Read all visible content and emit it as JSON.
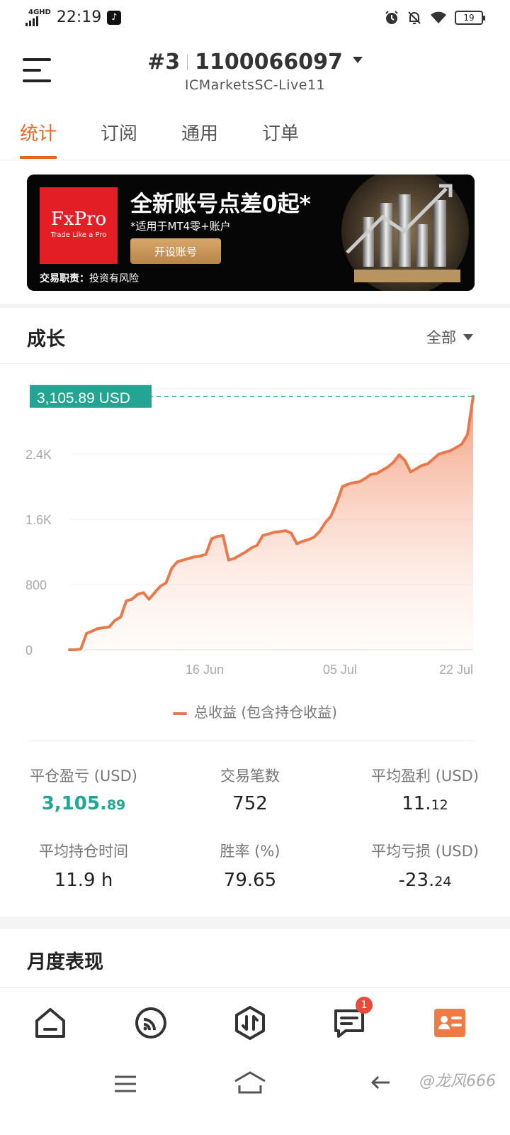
{
  "status_bar": {
    "network": "4GHD",
    "time": "22:19",
    "battery": "19"
  },
  "header": {
    "account_index": "#3",
    "account_number": "1100066097",
    "server": "ICMarketsSC-Live11"
  },
  "tabs": [
    {
      "label": "统计",
      "active": true
    },
    {
      "label": "订阅",
      "active": false
    },
    {
      "label": "通用",
      "active": false
    },
    {
      "label": "订单",
      "active": false
    }
  ],
  "banner": {
    "logo_brand": "FxPro",
    "logo_tagline": "Trade Like a Pro",
    "title": "全新账号点差0起*",
    "subtitle": "*适用于MT4零+账户",
    "button": "开设账号",
    "risk_label": "交易职责：",
    "risk_text": "投资有风险"
  },
  "growth": {
    "title": "成长",
    "filter": "全部"
  },
  "chart_data": {
    "type": "area",
    "current_value_label": "3,105.89 USD",
    "y_ticks": [
      "2.4K",
      "1.6K",
      "800",
      "0"
    ],
    "y_tick_values": [
      2400,
      1600,
      800,
      0
    ],
    "ylim": [
      0,
      3200
    ],
    "x_ticks": [
      "16 Jun",
      "05 Jul",
      "22 Jul"
    ],
    "series": [
      {
        "name": "总收益 (包含持仓收益)",
        "values": [
          0,
          0,
          10,
          200,
          230,
          260,
          270,
          280,
          360,
          400,
          600,
          620,
          680,
          700,
          620,
          700,
          780,
          820,
          1000,
          1080,
          1100,
          1120,
          1140,
          1150,
          1170,
          1360,
          1390,
          1400,
          1100,
          1120,
          1160,
          1200,
          1250,
          1280,
          1400,
          1420,
          1440,
          1450,
          1460,
          1430,
          1300,
          1330,
          1350,
          1380,
          1450,
          1560,
          1640,
          1800,
          2000,
          2030,
          2050,
          2060,
          2100,
          2150,
          2160,
          2200,
          2240,
          2300,
          2390,
          2320,
          2180,
          2220,
          2260,
          2280,
          2340,
          2400,
          2420,
          2440,
          2480,
          2520,
          2640,
          3105.89
        ],
        "color": "#e8794a"
      }
    ]
  },
  "stats": [
    {
      "label": "平仓盈亏 (USD)",
      "int": "3,105.",
      "dec": "89",
      "highlight": true
    },
    {
      "label": "交易笔数",
      "int": "752",
      "dec": "",
      "highlight": false
    },
    {
      "label": "平均盈利 (USD)",
      "int": "11.",
      "dec": "12",
      "highlight": false
    },
    {
      "label": "平均持仓时间",
      "int": "11.9 h",
      "dec": "",
      "highlight": false
    },
    {
      "label": "胜率 (%)",
      "int": "79.65",
      "dec": "",
      "highlight": false
    },
    {
      "label": "平均亏损 (USD)",
      "int": "-23.",
      "dec": "24",
      "highlight": false
    }
  ],
  "monthly": {
    "title": "月度表现"
  },
  "bottom_nav": {
    "items": [
      "home-icon",
      "feed-icon",
      "trade-icon",
      "messages-icon",
      "profile-card-icon"
    ],
    "messages_badge": "1",
    "active_color": "#f07a45"
  },
  "watermark": "@龙风666",
  "colors": {
    "accent": "#e8661f",
    "positive": "#24a593"
  }
}
